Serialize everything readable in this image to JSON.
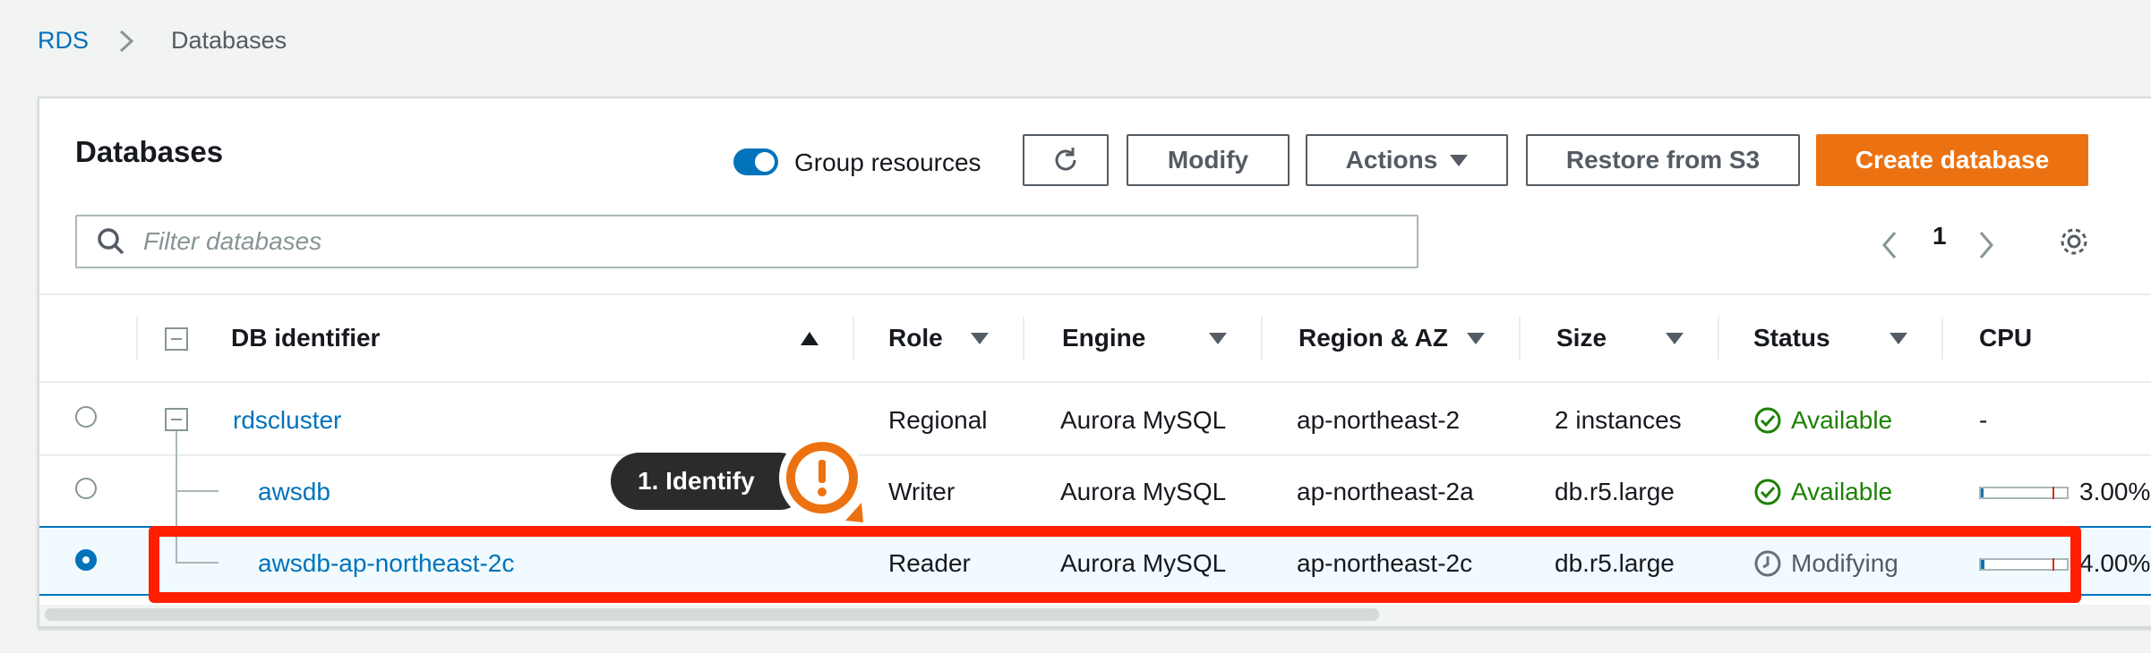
{
  "breadcrumb": {
    "root": "RDS",
    "current": "Databases"
  },
  "panel": {
    "title": "Databases",
    "group_resources_label": "Group resources",
    "buttons": {
      "modify": "Modify",
      "actions": "Actions",
      "restore": "Restore from S3",
      "create": "Create database"
    },
    "search_placeholder": "Filter databases",
    "page_number": "1"
  },
  "table": {
    "headers": [
      "DB identifier",
      "Role",
      "Engine",
      "Region & AZ",
      "Size",
      "Status",
      "CPU"
    ],
    "rows": [
      {
        "id": "rdscluster",
        "role": "Regional",
        "engine": "Aurora MySQL",
        "region": "ap-northeast-2",
        "size": "2 instances",
        "status": "Available",
        "cpu": "-"
      },
      {
        "id": "awsdb",
        "role": "Writer",
        "engine": "Aurora MySQL",
        "region": "ap-northeast-2a",
        "size": "db.r5.large",
        "status": "Available",
        "cpu": "3.00%"
      },
      {
        "id": "awsdb-ap-northeast-2c",
        "role": "Reader",
        "engine": "Aurora MySQL",
        "region": "ap-northeast-2c",
        "size": "db.r5.large",
        "status": "Modifying",
        "cpu": "4.00%"
      }
    ]
  },
  "callout": {
    "label": "1. Identify"
  },
  "colors": {
    "accent": "#0073bb",
    "primary_button": "#ec7211",
    "highlight": "#ff1e00",
    "available": "#1d8102"
  }
}
